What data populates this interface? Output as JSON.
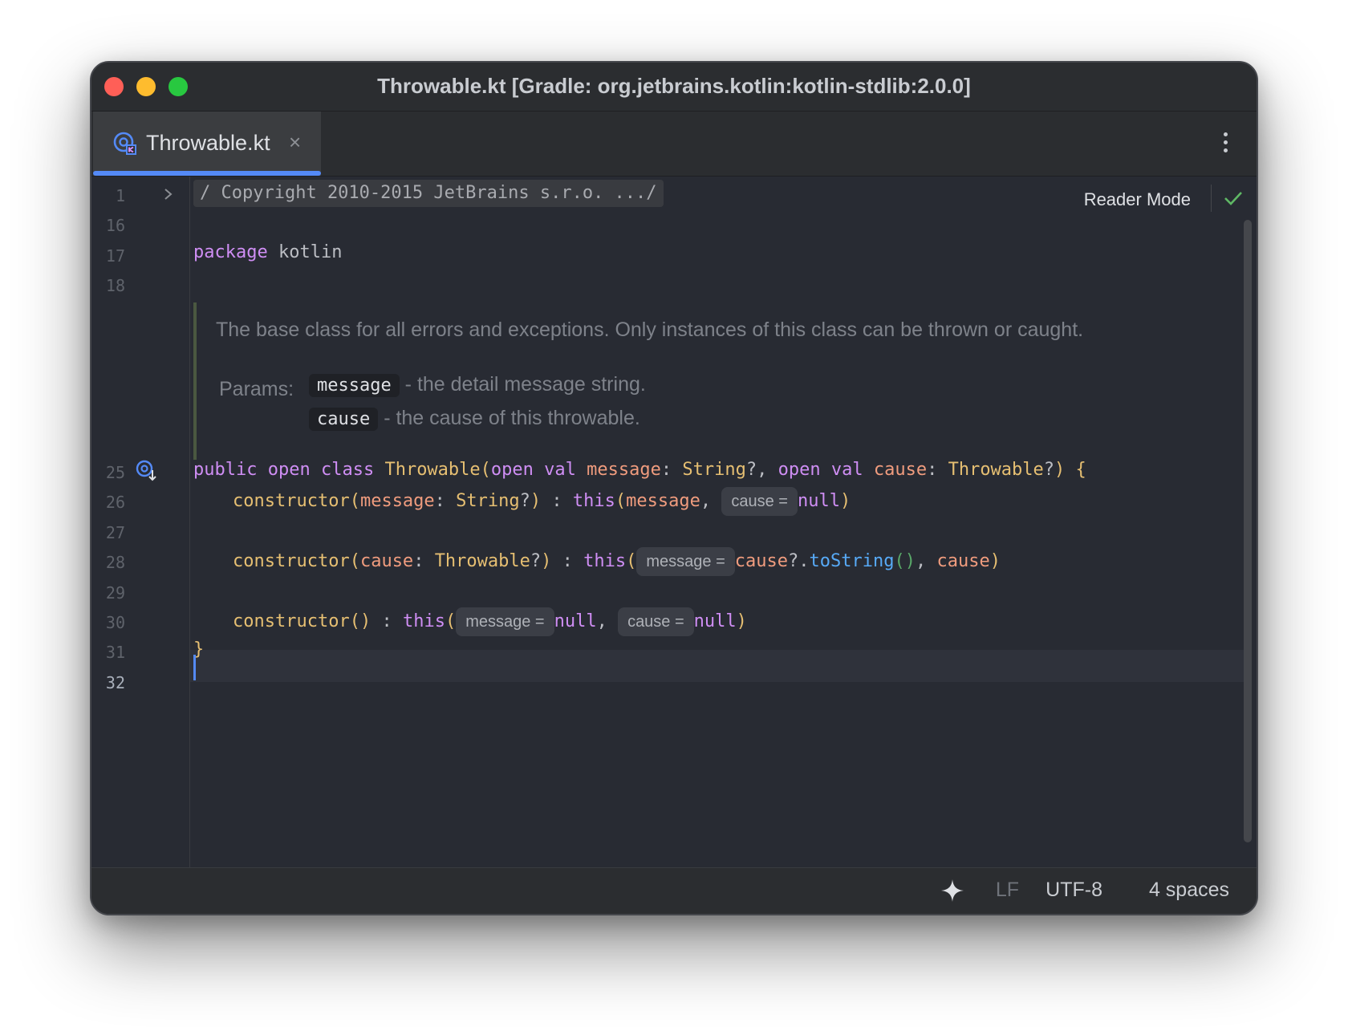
{
  "window": {
    "title": "Throwable.kt [Gradle: org.jetbrains.kotlin:kotlin-stdlib:2.0.0]"
  },
  "tabs": [
    {
      "label": "Throwable.kt",
      "icon": "kotlin-class-icon",
      "close": "×",
      "active": true
    }
  ],
  "editor": {
    "reader_mode_label": "Reader Mode",
    "line_numbers": [
      "1",
      "16",
      "17",
      "18",
      "25",
      "26",
      "27",
      "28",
      "29",
      "30",
      "31",
      "32"
    ],
    "current_line": "32",
    "folded_header": "/ Copyright 2010-2015 JetBrains s.r.o. .../",
    "package": {
      "keyword": "package",
      "name": "kotlin"
    },
    "doc": {
      "summary": "The base class for all errors and exceptions. Only instances of this class can be thrown or caught.",
      "params_label": "Params:",
      "params": [
        {
          "name": "message",
          "desc": "- the detail message string."
        },
        {
          "name": "cause",
          "desc": "- the cause of this throwable."
        }
      ]
    },
    "tokens": {
      "public": "public",
      "open": "open",
      "class": "class",
      "val": "val",
      "class_name": "Throwable",
      "message": "message",
      "cause": "cause",
      "string_type": "String",
      "nullable": "?",
      "constructor": "constructor",
      "this": "this",
      "null": "null",
      "to_string": "toString",
      "lparen": "(",
      "rparen": ")",
      "lbrace": "{",
      "rbrace": "}",
      "colon_sp": ": ",
      "comma_sp": ", ",
      "delegate": " : ",
      "safe_call": "?.",
      "open_paren_sp_open": "(open ",
      "sp": " ",
      "open_brace": "?) {",
      "q_paren": "?)"
    },
    "hints": {
      "cause": "cause =",
      "message": "message ="
    }
  },
  "status_bar": {
    "ai_icon": "ai-sparkle-icon",
    "line_separator": "LF",
    "encoding": "UTF-8",
    "indent": "4 spaces"
  },
  "colors": {
    "accent": "#548af7",
    "keyword": "#cf8ef4",
    "function": "#e6bf72",
    "parameter": "#f09c7e",
    "call": "#57aaf7",
    "editor_bg": "#282b33"
  }
}
